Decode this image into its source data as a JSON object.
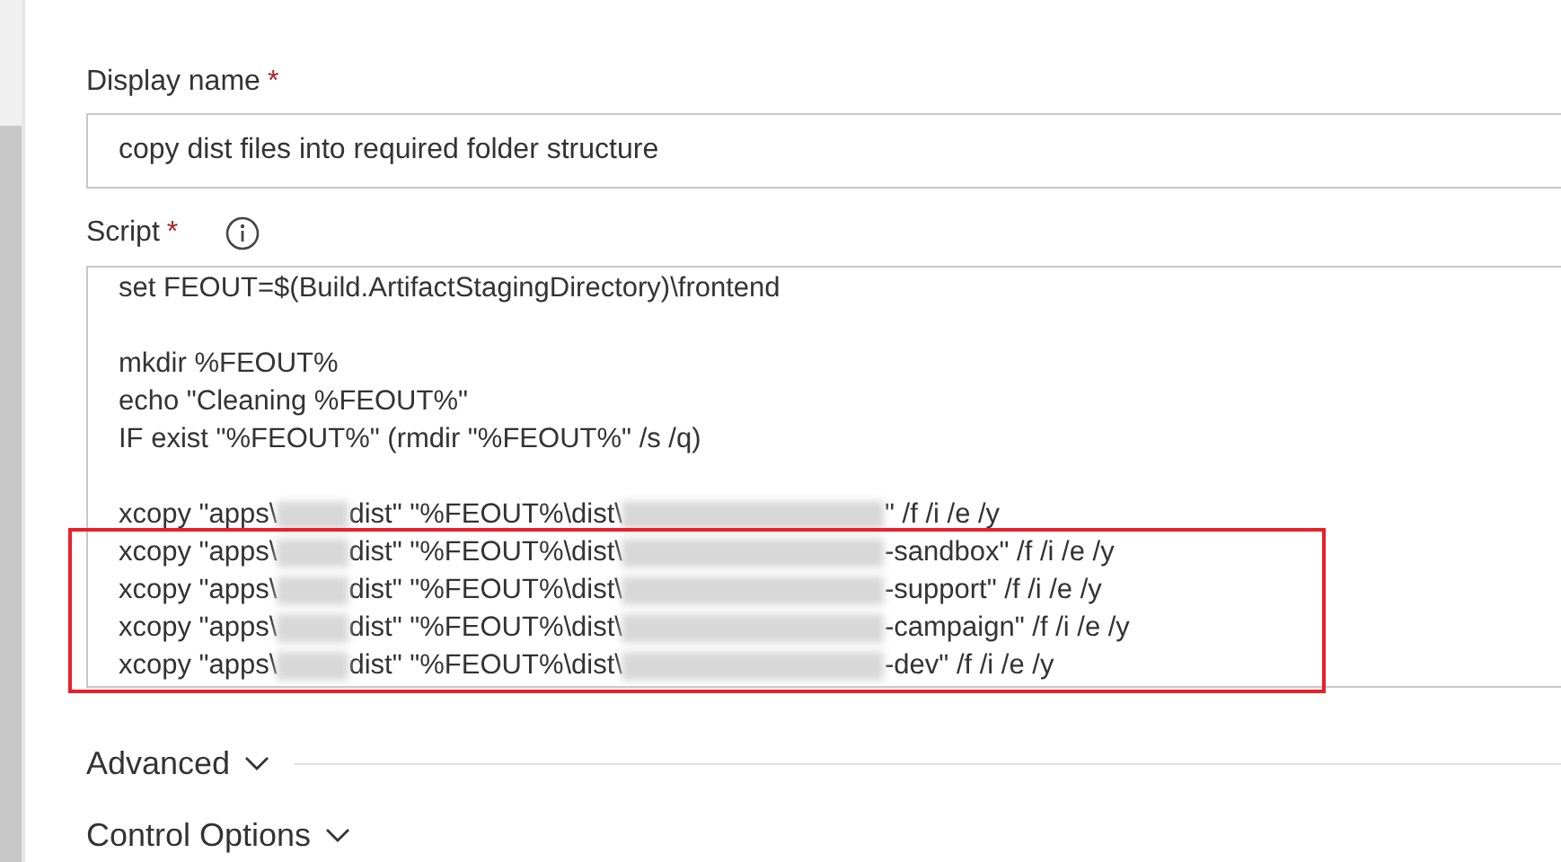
{
  "display_name": {
    "label": "Display name",
    "required_mark": "*",
    "value": "copy dist files into required folder structure"
  },
  "script": {
    "label": "Script",
    "required_mark": "*",
    "lines": [
      {
        "segments": [
          {
            "kind": "text",
            "text": "set FEOUT=$(Build.ArtifactStagingDirectory)\\frontend"
          }
        ],
        "highlighted": false
      },
      {
        "highlighted": false
      },
      {
        "segments": [
          {
            "kind": "text",
            "text": "mkdir %FEOUT%"
          }
        ],
        "highlighted": false
      },
      {
        "segments": [
          {
            "kind": "text",
            "text": "echo \"Cleaning %FEOUT%\""
          }
        ],
        "highlighted": false
      },
      {
        "segments": [
          {
            "kind": "text",
            "text": "IF exist \"%FEOUT%\" (rmdir \"%FEOUT%\" /s /q)"
          }
        ],
        "highlighted": false
      },
      {
        "highlighted": false
      },
      {
        "segments": [
          {
            "kind": "text",
            "text": "xcopy \"apps\\"
          },
          {
            "kind": "redacted"
          },
          {
            "kind": "text",
            "text": "dist\" \"%FEOUT%\\dist\\"
          },
          {
            "kind": "redacted_long"
          },
          {
            "kind": "text",
            "text": "\" /f /i /e /y"
          }
        ],
        "highlighted": false
      },
      {
        "segments": [
          {
            "kind": "text",
            "text": "xcopy \"apps\\"
          },
          {
            "kind": "redacted"
          },
          {
            "kind": "text",
            "text": "dist\" \"%FEOUT%\\dist\\"
          },
          {
            "kind": "redacted_long"
          },
          {
            "kind": "text",
            "text": "-sandbox\" /f /i /e /y"
          }
        ],
        "highlighted": true
      },
      {
        "segments": [
          {
            "kind": "text",
            "text": "xcopy \"apps\\"
          },
          {
            "kind": "redacted"
          },
          {
            "kind": "text",
            "text": "dist\" \"%FEOUT%\\dist\\"
          },
          {
            "kind": "redacted_long"
          },
          {
            "kind": "text",
            "text": "-support\" /f /i /e /y"
          }
        ],
        "highlighted": true
      },
      {
        "segments": [
          {
            "kind": "text",
            "text": "xcopy \"apps\\"
          },
          {
            "kind": "redacted"
          },
          {
            "kind": "text",
            "text": "dist\" \"%FEOUT%\\dist\\"
          },
          {
            "kind": "redacted_long"
          },
          {
            "kind": "text",
            "text": "-campaign\" /f /i /e /y"
          }
        ],
        "highlighted": true
      },
      {
        "segments": [
          {
            "kind": "text",
            "text": "xcopy \"apps\\"
          },
          {
            "kind": "redacted"
          },
          {
            "kind": "text",
            "text": "dist\" \"%FEOUT%\\dist\\"
          },
          {
            "kind": "redacted_long"
          },
          {
            "kind": "text",
            "text": "-dev\" /f /i /e /y"
          }
        ],
        "highlighted": true
      }
    ]
  },
  "sections": [
    {
      "title": "Advanced",
      "expanded": false
    },
    {
      "title": "Control Options",
      "expanded": false
    }
  ]
}
